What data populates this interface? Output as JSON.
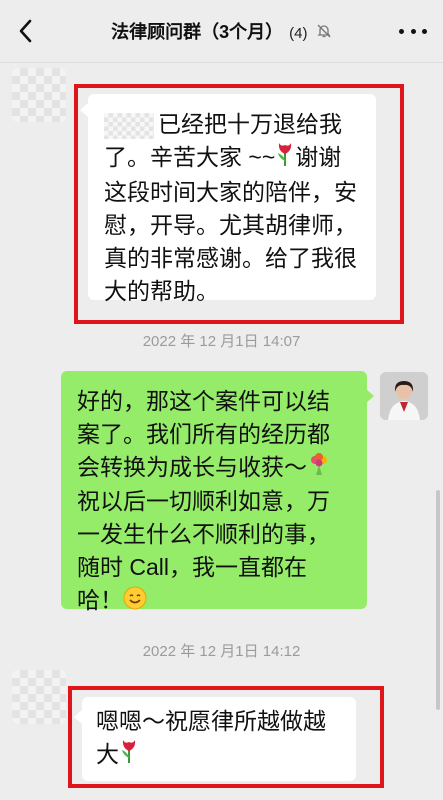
{
  "header": {
    "title": "法律顾问群（3个月）",
    "count": "(4)",
    "back_icon": "chevron-left-icon",
    "mute_icon": "bell-off-icon",
    "more_icon": "more-dots-icon"
  },
  "messages": [
    {
      "side": "left",
      "text_line1": "已经把十万退给我",
      "text_rest": "了。辛苦大家 ~~",
      "text_after_emoji": "谢谢这段时间大家的陪伴，安慰，开导。尤其胡律师，真的非常感谢。给了我很大的帮助。",
      "emoji": "tulip"
    },
    {
      "side": "right",
      "text_before_emoji": "好的，那这个案件可以结案了。我们所有的经历都会转换为成长与收获～",
      "text_mid": "祝以后一切顺利如意，万一发生什么不顺利的事，随时 Call，我一直都在哈！",
      "emoji1": "bouquet",
      "emoji2": "smile"
    },
    {
      "side": "left",
      "text": "嗯嗯～祝愿律所越做越大",
      "emoji": "tulip"
    }
  ],
  "timestamps": [
    "2022 年 12 月1日 14:07",
    "2022 年 12 月1日 14:12"
  ],
  "colors": {
    "red_box": "#e0141b",
    "green_bubble": "#95ec69"
  }
}
